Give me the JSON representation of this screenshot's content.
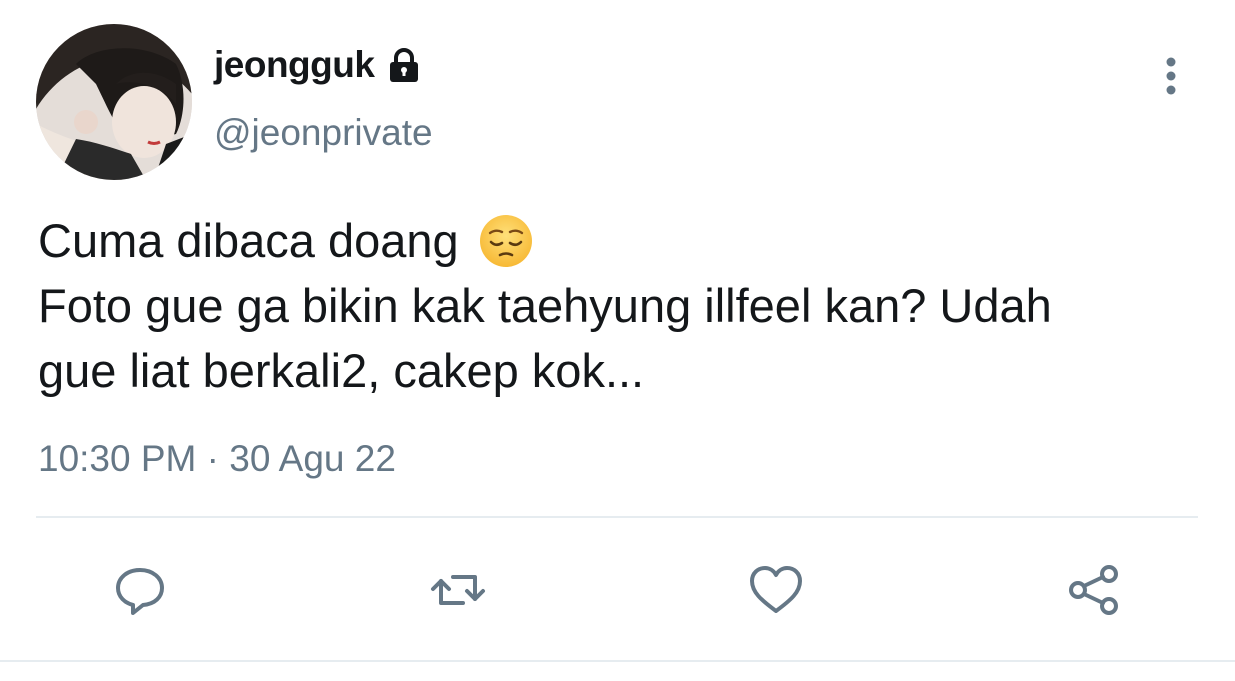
{
  "tweet": {
    "display_name": "jeongguk",
    "handle": "@jeonprivate",
    "text_lines": [
      "Cuma dibaca doang",
      "Foto gue ga bikin kak taehyung illfeel kan? Udah",
      "gue liat berkali2, cakep kok..."
    ],
    "emoji": "pensive-face",
    "timestamp": "10:30 PM · 30 Agu 22",
    "protected_icon": "lock-icon"
  },
  "actions": {
    "reply_icon": "comment-bubble-icon",
    "retweet_icon": "retweet-icon",
    "like_icon": "heart-icon",
    "share_icon": "share-icon"
  },
  "colors": {
    "text_primary": "#14171a",
    "text_secondary": "#657786",
    "divider": "#e6ecf0",
    "icon": "#657786"
  }
}
